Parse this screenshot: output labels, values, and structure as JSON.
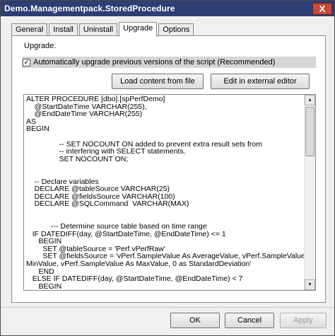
{
  "window": {
    "title": "Demo.Managementpack.StoredProcedure",
    "close_glyph": "X"
  },
  "tabs": [
    {
      "label": "General"
    },
    {
      "label": "Install"
    },
    {
      "label": "Uninstall"
    },
    {
      "label": "Upgrade"
    },
    {
      "label": "Options"
    }
  ],
  "upgrade": {
    "section_label": "Upgrade:",
    "auto_upgrade_label": "Automatically upgrade previous versions of the script (Recommended)",
    "auto_upgrade_checked": true,
    "check_glyph": "✓",
    "load_button": "Load content from file",
    "edit_button": "Edit in external editor",
    "code": "ALTER PROCEDURE [dbo].[spPerfDemo]\n    @StartDateTime VARCHAR(255),\n    @EndDateTime VARCHAR(255)\nAS\nBEGIN\n\n                -- SET NOCOUNT ON added to prevent extra result sets from\n                -- interfering with SELECT statements.\n                SET NOCOUNT ON;\n\n\n    -- Declare variables\n    DECLARE @tableSource VARCHAR(25)\n    DECLARE @fieldsSource VARCHAR(100)\n    DECLARE @SQLCommand  VARCHAR(MAX)\n\n\n            --- Determine source table based on time range\n   IF DATEDIFF(day, @StartDateTime, @EndDateTime) <= 1\n      BEGIN\n        SET @tableSource = 'Perf.vPerfRaw'\n        SET @fieldsSource = 'vPerf.SampleValue As AverageValue, vPerf.SampleValue As\nMinValue, vPerf.SampleValue As MaxValue, 0 as StandardDeviation'\n      END\n   ELSE IF DATEDIFF(day, @StartDateTime, @EndDateTime) < 7\n      BEGIN"
  },
  "scrollbar": {
    "up_glyph": "▲",
    "down_glyph": "▼"
  },
  "footer": {
    "ok": "OK",
    "cancel": "Cancel",
    "apply": "Apply"
  }
}
